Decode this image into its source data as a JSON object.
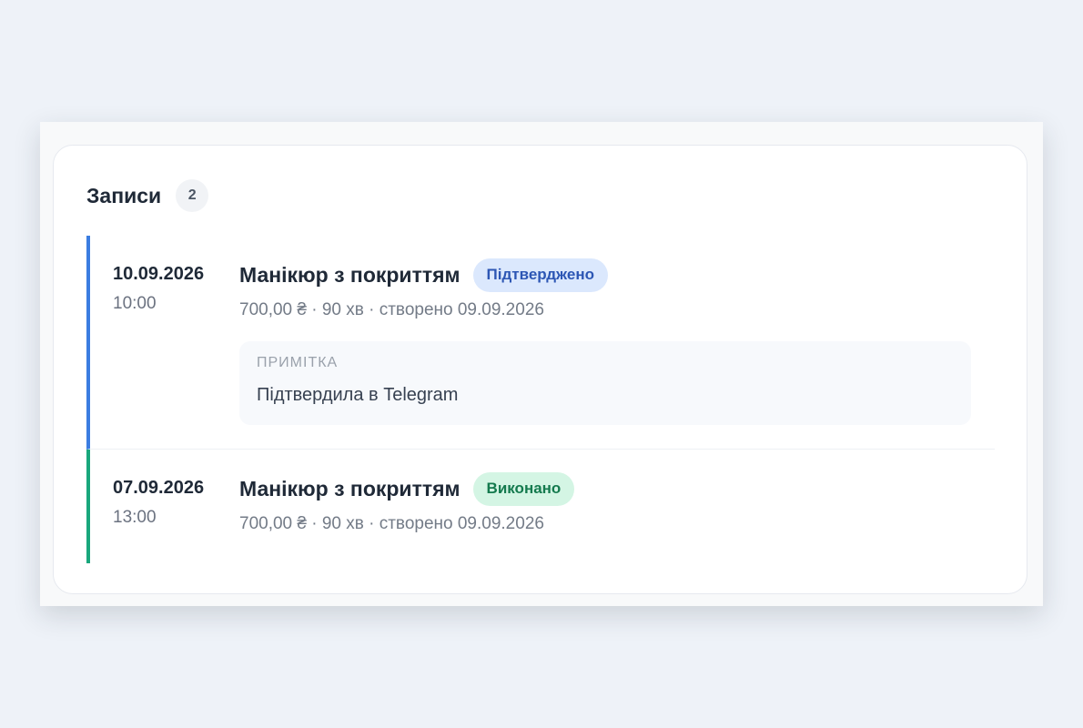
{
  "records": {
    "title": "Записи",
    "count": "2",
    "items": [
      {
        "date": "10.09.2026",
        "time": "10:00",
        "service": "Манікюр з покриттям",
        "status": "Підтверджено",
        "meta": "700,00 ₴ · 90 хв · створено 09.09.2026",
        "note_label": "ПРИМІТКА",
        "note_text": "Підтвердила в Telegram",
        "accent_color": "#3b7de1"
      },
      {
        "date": "07.09.2026",
        "time": "13:00",
        "service": "Манікюр з покриттям",
        "status": "Виконано",
        "meta": "700,00 ₴ · 90 хв · створено 09.09.2026",
        "accent_color": "#19a77c"
      }
    ]
  },
  "colors": {
    "page_background": "#eef2f8",
    "confirmed_badge_bg": "#dbe8fd",
    "confirmed_badge_text": "#2c56b4",
    "done_badge_bg": "#d4f5e4",
    "done_badge_text": "#147a4e"
  }
}
